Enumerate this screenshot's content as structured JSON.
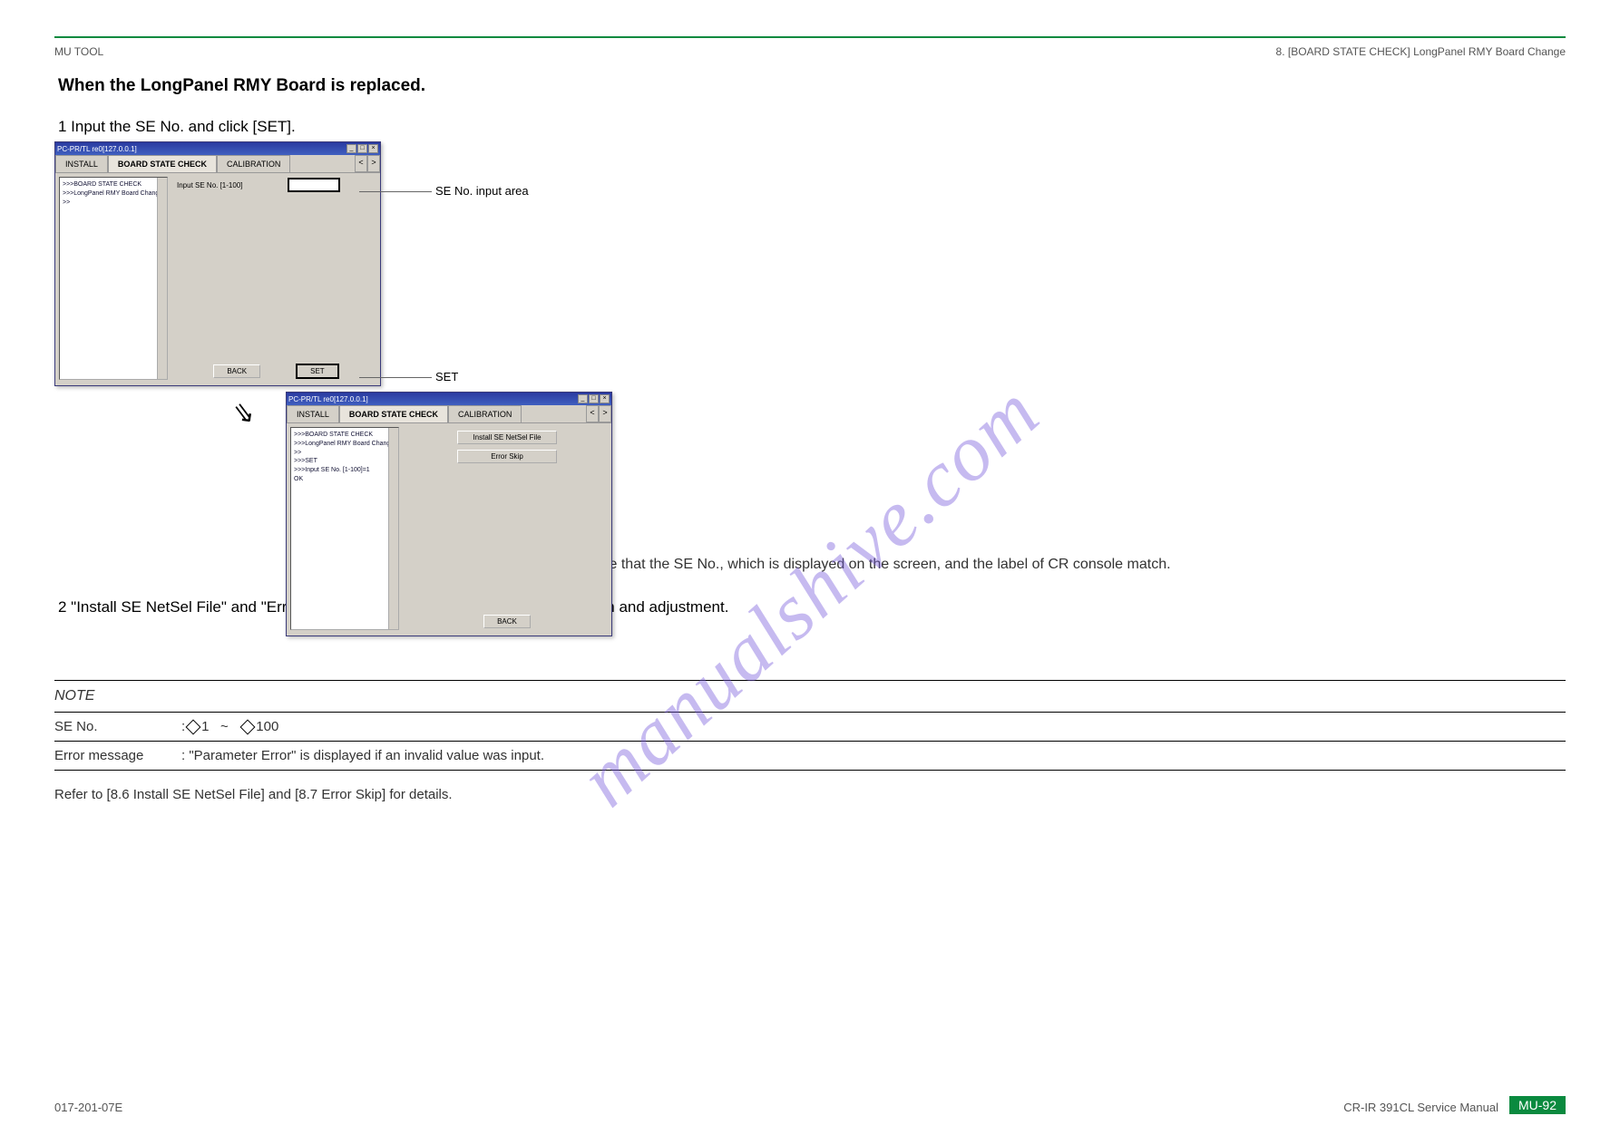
{
  "header": {
    "left": "MU TOOL",
    "right": "8. [BOARD STATE CHECK] LongPanel RMY Board Change"
  },
  "section_title": "When the LongPanel RMY Board is replaced.",
  "step1": "1 Input the SE No. and click [SET].",
  "label_se_input": "SE No. input area",
  "label_set": "SET",
  "screens": {
    "title": "PC-PR/TL re0[127.0.0.1]",
    "tabs": [
      "INSTALL",
      "BOARD STATE CHECK",
      "CALIBRATION"
    ],
    "nav_prev": "<",
    "nav_next": ">",
    "side1": [
      ">>>BOARD STATE CHECK",
      ">>>LongPanel RMY Board Change >>"
    ],
    "side2": [
      ">>>BOARD STATE CHECK",
      ">>>LongPanel RMY Board Change >>",
      "",
      ">>>SET",
      ">>>Input SE No. [1-100]=1",
      "OK"
    ],
    "main1_label": "Input SE No. [1-100]",
    "main2_btn1": "Install SE NetSel File",
    "main2_btn2": "Error Skip",
    "btn_back": "BACK",
    "btn_set": "SET",
    "win_min": "_",
    "win_max": "□",
    "win_close": "×"
  },
  "caution1": "(Caution) Make sure that the SE No., which is displayed on the screen, and the label of CR console match.",
  "step2": "2 \"Install SE NetSel File\" and \"Error Skip\" are displayed. Perform each installation and adjustment.",
  "notes": {
    "head": "NOTE",
    "row1_label": "SE No.",
    "row1_value": ": 1    ~     100",
    "row2_label": "Error message",
    "row2_value": ": \"Parameter Error\" is displayed if an invalid value was input.",
    "row_ref": "Refer to [8.6 Install SE NetSel File] and [8.7 Error Skip] for details."
  },
  "footer": {
    "left": "017-201-07E",
    "mid": "CR-IR 391CL Service Manual",
    "page": "MU-92"
  },
  "watermark": "manualshive.com"
}
